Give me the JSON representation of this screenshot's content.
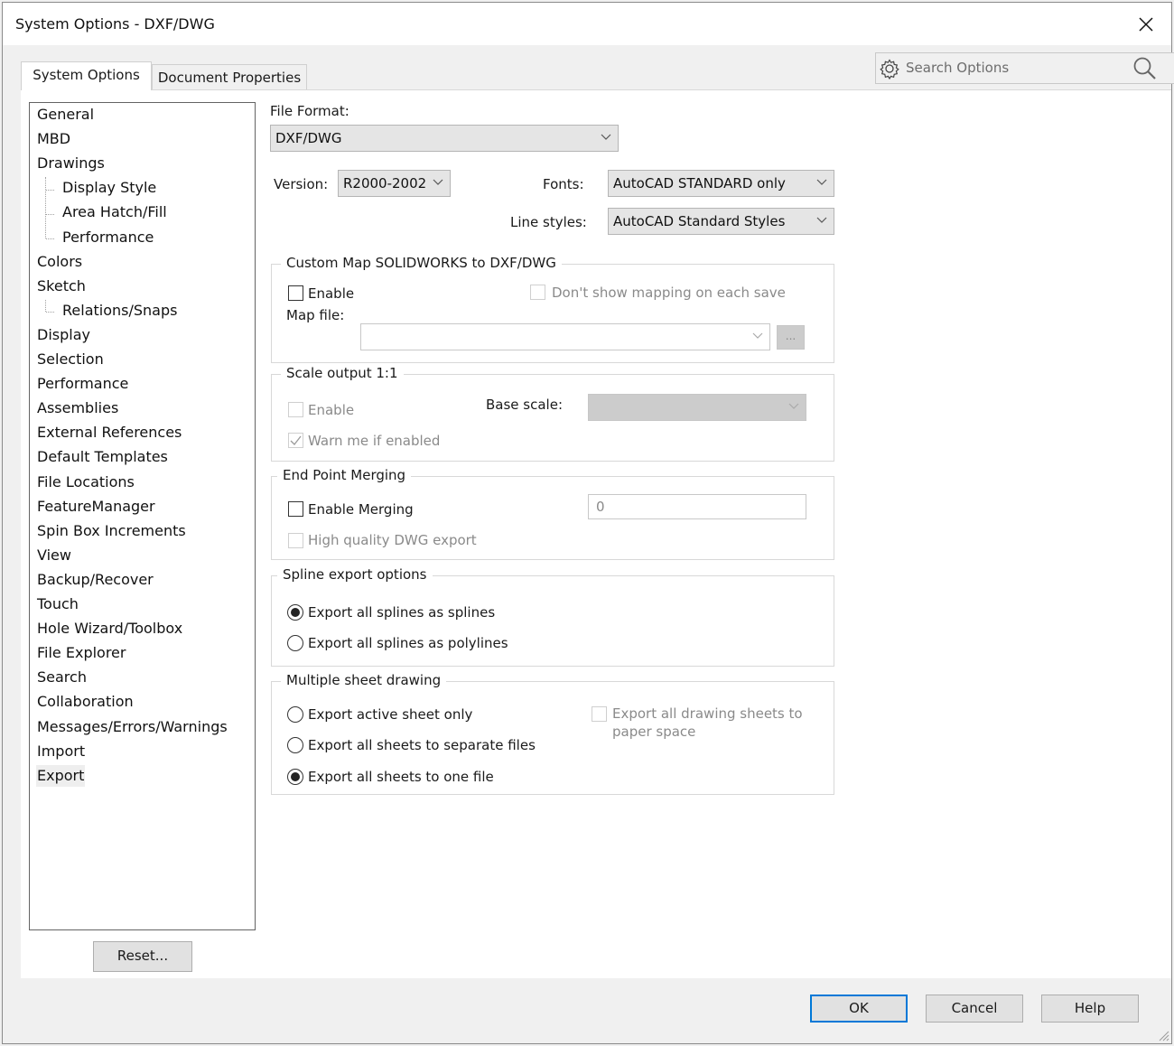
{
  "window": {
    "title": "System Options - DXF/DWG"
  },
  "tabs": [
    {
      "label": "System Options",
      "active": true
    },
    {
      "label": "Document Properties",
      "active": false
    }
  ],
  "search": {
    "placeholder": "Search Options"
  },
  "tree": {
    "items": [
      {
        "label": "General",
        "level": 0
      },
      {
        "label": "MBD",
        "level": 0
      },
      {
        "label": "Drawings",
        "level": 0
      },
      {
        "label": "Display Style",
        "level": 1
      },
      {
        "label": "Area Hatch/Fill",
        "level": 1
      },
      {
        "label": "Performance",
        "level": 1
      },
      {
        "label": "Colors",
        "level": 0
      },
      {
        "label": "Sketch",
        "level": 0
      },
      {
        "label": "Relations/Snaps",
        "level": 1
      },
      {
        "label": "Display",
        "level": 0
      },
      {
        "label": "Selection",
        "level": 0
      },
      {
        "label": "Performance",
        "level": 0
      },
      {
        "label": "Assemblies",
        "level": 0
      },
      {
        "label": "External References",
        "level": 0
      },
      {
        "label": "Default Templates",
        "level": 0
      },
      {
        "label": "File Locations",
        "level": 0
      },
      {
        "label": "FeatureManager",
        "level": 0
      },
      {
        "label": "Spin Box Increments",
        "level": 0
      },
      {
        "label": "View",
        "level": 0
      },
      {
        "label": "Backup/Recover",
        "level": 0
      },
      {
        "label": "Touch",
        "level": 0
      },
      {
        "label": "Hole Wizard/Toolbox",
        "level": 0
      },
      {
        "label": "File Explorer",
        "level": 0
      },
      {
        "label": "Search",
        "level": 0
      },
      {
        "label": "Collaboration",
        "level": 0
      },
      {
        "label": "Messages/Errors/Warnings",
        "level": 0
      },
      {
        "label": "Import",
        "level": 0
      },
      {
        "label": "Export",
        "level": 0,
        "selected": true
      }
    ],
    "reset_label": "Reset..."
  },
  "main": {
    "file_format": {
      "label": "File Format:",
      "value": "DXF/DWG"
    },
    "version": {
      "label": "Version:",
      "value": "R2000-2002"
    },
    "fonts": {
      "label": "Fonts:",
      "value": "AutoCAD STANDARD only"
    },
    "line_styles": {
      "label": "Line styles:",
      "value": "AutoCAD Standard Styles"
    },
    "custom_map": {
      "title": "Custom Map SOLIDWORKS to DXF/DWG",
      "enable_label": "Enable",
      "enable_checked": false,
      "dont_show_label": "Don't show mapping on each save",
      "dont_show_checked": false,
      "map_file_label": "Map file:",
      "map_file_value": "",
      "browse_label": "..."
    },
    "scale_output": {
      "title": "Scale output 1:1",
      "enable_label": "Enable",
      "enable_checked": false,
      "base_scale_label": "Base scale:",
      "base_scale_value": "",
      "warn_label": "Warn me if enabled",
      "warn_checked": true
    },
    "end_point_merging": {
      "title": "End Point Merging",
      "enable_label": "Enable Merging",
      "enable_checked": false,
      "merge_value": "0",
      "hq_label": "High quality DWG export",
      "hq_checked": false
    },
    "spline_export": {
      "title": "Spline export options",
      "options": [
        {
          "label": "Export all splines as splines",
          "selected": true
        },
        {
          "label": "Export all splines as polylines",
          "selected": false
        }
      ]
    },
    "multiple_sheet": {
      "title": "Multiple sheet drawing",
      "options": [
        {
          "label": "Export active sheet only",
          "selected": false
        },
        {
          "label": "Export all sheets to separate files",
          "selected": false
        },
        {
          "label": "Export all sheets to one file",
          "selected": true
        }
      ],
      "paper_space_label_1": "Export all drawing sheets to",
      "paper_space_label_2": "paper space",
      "paper_space_checked": false
    }
  },
  "footer": {
    "ok_label": "OK",
    "cancel_label": "Cancel",
    "help_label": "Help"
  }
}
